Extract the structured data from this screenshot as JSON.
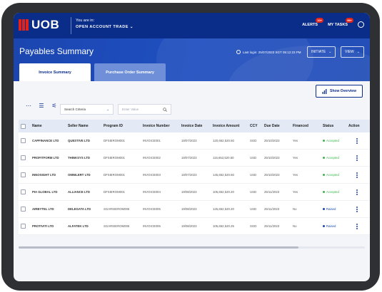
{
  "header": {
    "logo_text": "UOB",
    "context_label": "You are in:",
    "context_value": "OPEN ACCOUNT TRADE",
    "alerts_label": "ALERTS",
    "alerts_badge": "10+",
    "tasks_label": "MY TASKS",
    "tasks_badge": "99+",
    "chevron": "⌄"
  },
  "page": {
    "title": "Payables Summary",
    "last_login": "Last login: 25/07/2023 SGT 05:12:23 PM",
    "initiate_label": "INITIATE",
    "view_label": "VIEW"
  },
  "tabs": {
    "invoice_summary": "Invoice Summary",
    "purchase_order_summary": "Purchase Order Summary"
  },
  "toolbar": {
    "show_overview": "Show Overview",
    "search_criteria": "Search Criteria",
    "filter_placeholder": "Enter Value"
  },
  "table": {
    "headers": [
      "Name",
      "Seller Name",
      "Program ID",
      "Invoice Number",
      "Invoice Date",
      "Invoice Amount",
      "CCY",
      "Due Date",
      "Financed",
      "Status",
      "Action"
    ],
    "rows": [
      {
        "name": "CAPFINANCE LTD",
        "seller": "QUESTIVE LTD",
        "program": "DFSIEROM001",
        "invoice": "INVOICE001",
        "inv_date": "19/07/2023",
        "amount": "120,652,520.50",
        "ccy": "SGD",
        "due": "25/10/2023",
        "financed": "Yes",
        "status": "Accepted",
        "status_color": "#3bb54a"
      },
      {
        "name": "PROFITFORM LTD",
        "seller": "THINKSYS LTD",
        "program": "DFSIEROM001",
        "invoice": "INVOICE002",
        "inv_date": "19/07/2023",
        "amount": "115,652,520.50",
        "ccy": "USD",
        "due": "25/10/2023",
        "financed": "Yes",
        "status": "Accepted",
        "status_color": "#3bb54a"
      },
      {
        "name": "INNOSIGHT LTD",
        "seller": "OMNILERT LTD",
        "program": "DFSIEROM001",
        "invoice": "INVOICE003",
        "inv_date": "19/07/2023",
        "amount": "145,652,520.50",
        "ccy": "USD",
        "due": "25/10/2023",
        "financed": "Yes",
        "status": "Accepted",
        "status_color": "#3bb54a"
      },
      {
        "name": "PIA GLOBAL LTD",
        "seller": "ALLIANCE LTD",
        "program": "DFSIEROM001",
        "invoice": "INVOICE004",
        "inv_date": "19/08/2023",
        "amount": "105,652,520.20",
        "ccy": "USD",
        "due": "25/11/2023",
        "financed": "Yes",
        "status": "Accepted",
        "status_color": "#3bb54a"
      },
      {
        "name": "AIRBYTEL LTD",
        "seller": "DELEGATA LTD",
        "program": "SGARSIEROM006",
        "invoice": "INVOICE005",
        "inv_date": "19/08/2023",
        "amount": "125,652,520.20",
        "ccy": "USD",
        "due": "25/11/2023",
        "financed": "No",
        "status": "Raised",
        "status_color": "#1b46b0"
      },
      {
        "name": "PROTIVITI LTD",
        "seller": "ALFATEK LTD",
        "program": "SGARSIEROM006",
        "invoice": "INVOICE006",
        "inv_date": "19/08/2023",
        "amount": "105,652,520.25",
        "ccy": "SGD",
        "due": "25/11/2023",
        "financed": "No",
        "status": "Raised",
        "status_color": "#1b46b0"
      }
    ]
  },
  "colors": {
    "brand_navy": "#0b2d8a",
    "brand_red": "#e2231a",
    "accepted": "#3bb54a",
    "raised": "#1b46b0"
  }
}
